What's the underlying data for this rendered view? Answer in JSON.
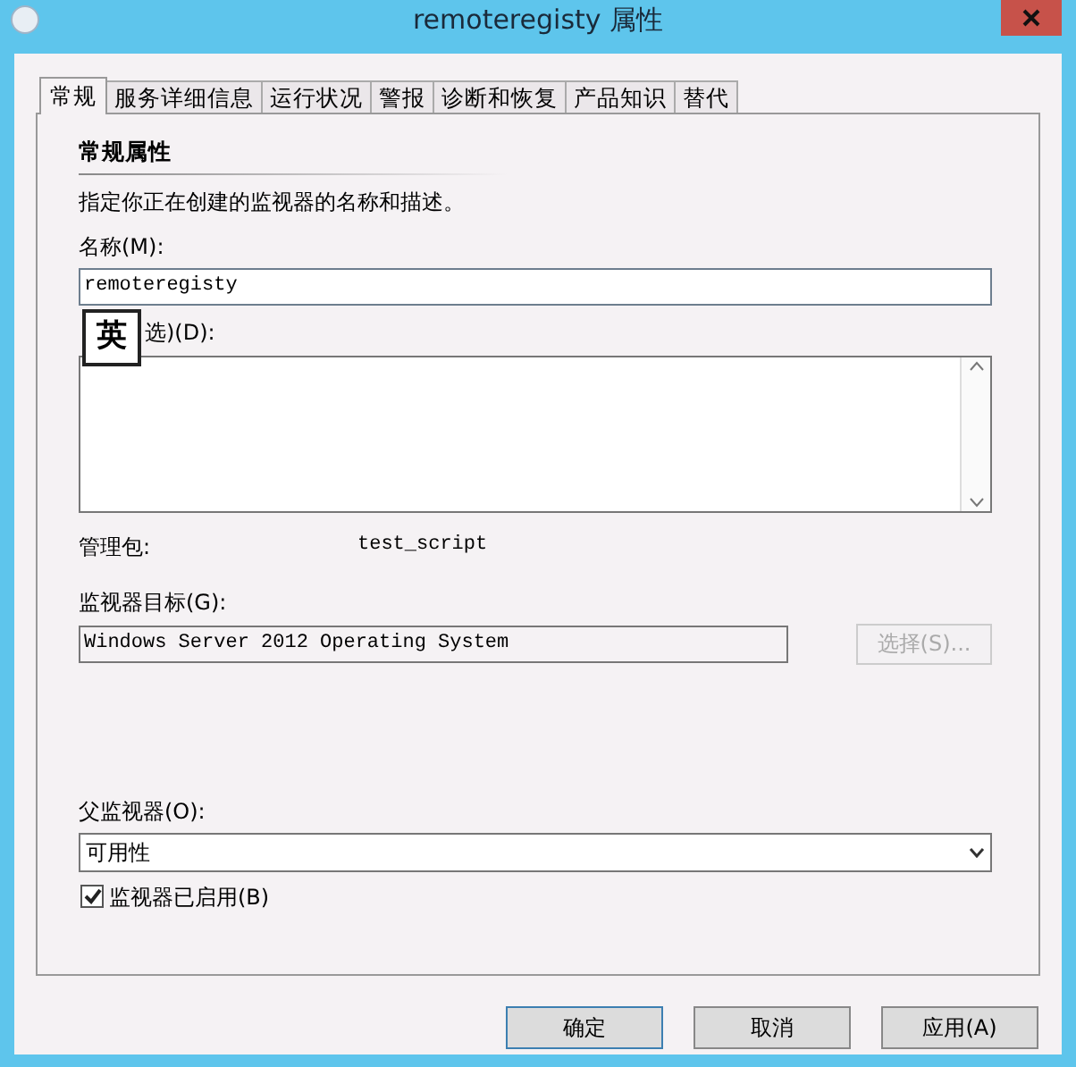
{
  "window": {
    "title": "remoteregisty 属性"
  },
  "tabs": [
    {
      "label": "常规",
      "selected": true
    },
    {
      "label": "服务详细信息",
      "selected": false
    },
    {
      "label": "运行状况",
      "selected": false
    },
    {
      "label": "警报",
      "selected": false
    },
    {
      "label": "诊断和恢复",
      "selected": false
    },
    {
      "label": "产品知识",
      "selected": false
    },
    {
      "label": "替代",
      "selected": false
    }
  ],
  "section": {
    "title": "常规属性",
    "description": "指定你正在创建的监视器的名称和描述。"
  },
  "name_field": {
    "label": "名称(M):",
    "value": "remoteregisty"
  },
  "ime_indicator": "英",
  "description_field": {
    "label": "选)(D):"
  },
  "management_pack": {
    "label": "管理包:",
    "value": "test_script"
  },
  "monitor_target": {
    "label": "监视器目标(G):",
    "value": "Windows Server 2012 Operating System",
    "button": {
      "label": "选择(S)...",
      "disabled": true
    }
  },
  "parent_monitor": {
    "label": "父监视器(O):",
    "value": "可用性"
  },
  "enabled_checkbox": {
    "label": "监视器已启用(B)",
    "checked": true
  },
  "buttons": [
    {
      "label": "确定",
      "default": true
    },
    {
      "label": "取消",
      "default": false
    },
    {
      "label": "应用(A)",
      "default": false
    }
  ]
}
